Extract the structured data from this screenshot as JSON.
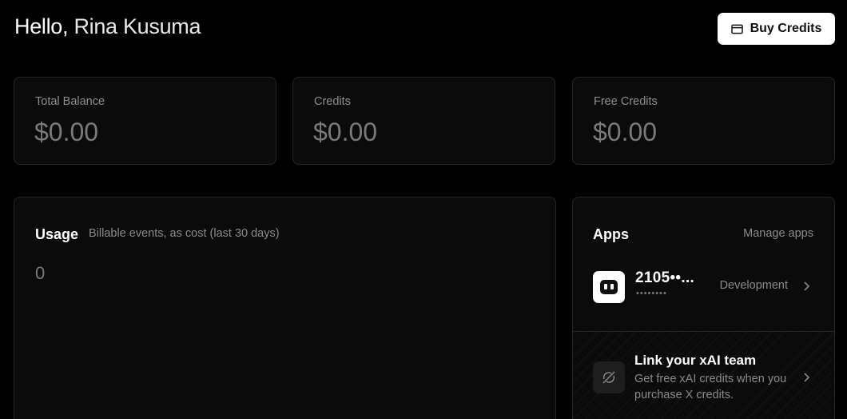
{
  "header": {
    "hello": "Hello,",
    "name": "Rina Kusuma",
    "buy_credits_label": "Buy Credits",
    "buy_credits_icon": "credit-card-icon"
  },
  "stats": [
    {
      "label": "Total Balance",
      "value": "$0.00"
    },
    {
      "label": "Credits",
      "value": "$0.00"
    },
    {
      "label": "Free Credits",
      "value": "$0.00"
    }
  ],
  "usage": {
    "title": "Usage",
    "subtitle": "Billable events, as cost (last 30 days)",
    "value": "0"
  },
  "apps": {
    "title": "Apps",
    "manage_label": "Manage apps",
    "items": [
      {
        "name": "2105••...",
        "secret": "••••••••",
        "environment": "Development",
        "icon": "app-logo-icon"
      }
    ],
    "link_team": {
      "title": "Link your xAI team",
      "description": "Get free xAI credits when you purchase X credits.",
      "icon": "link-broken-icon"
    }
  },
  "colors": {
    "background": "#000000",
    "card": "#0b0b0b",
    "border": "#262626",
    "muted_text": "#8a8a8a",
    "value_text": "#7a7a7a"
  }
}
